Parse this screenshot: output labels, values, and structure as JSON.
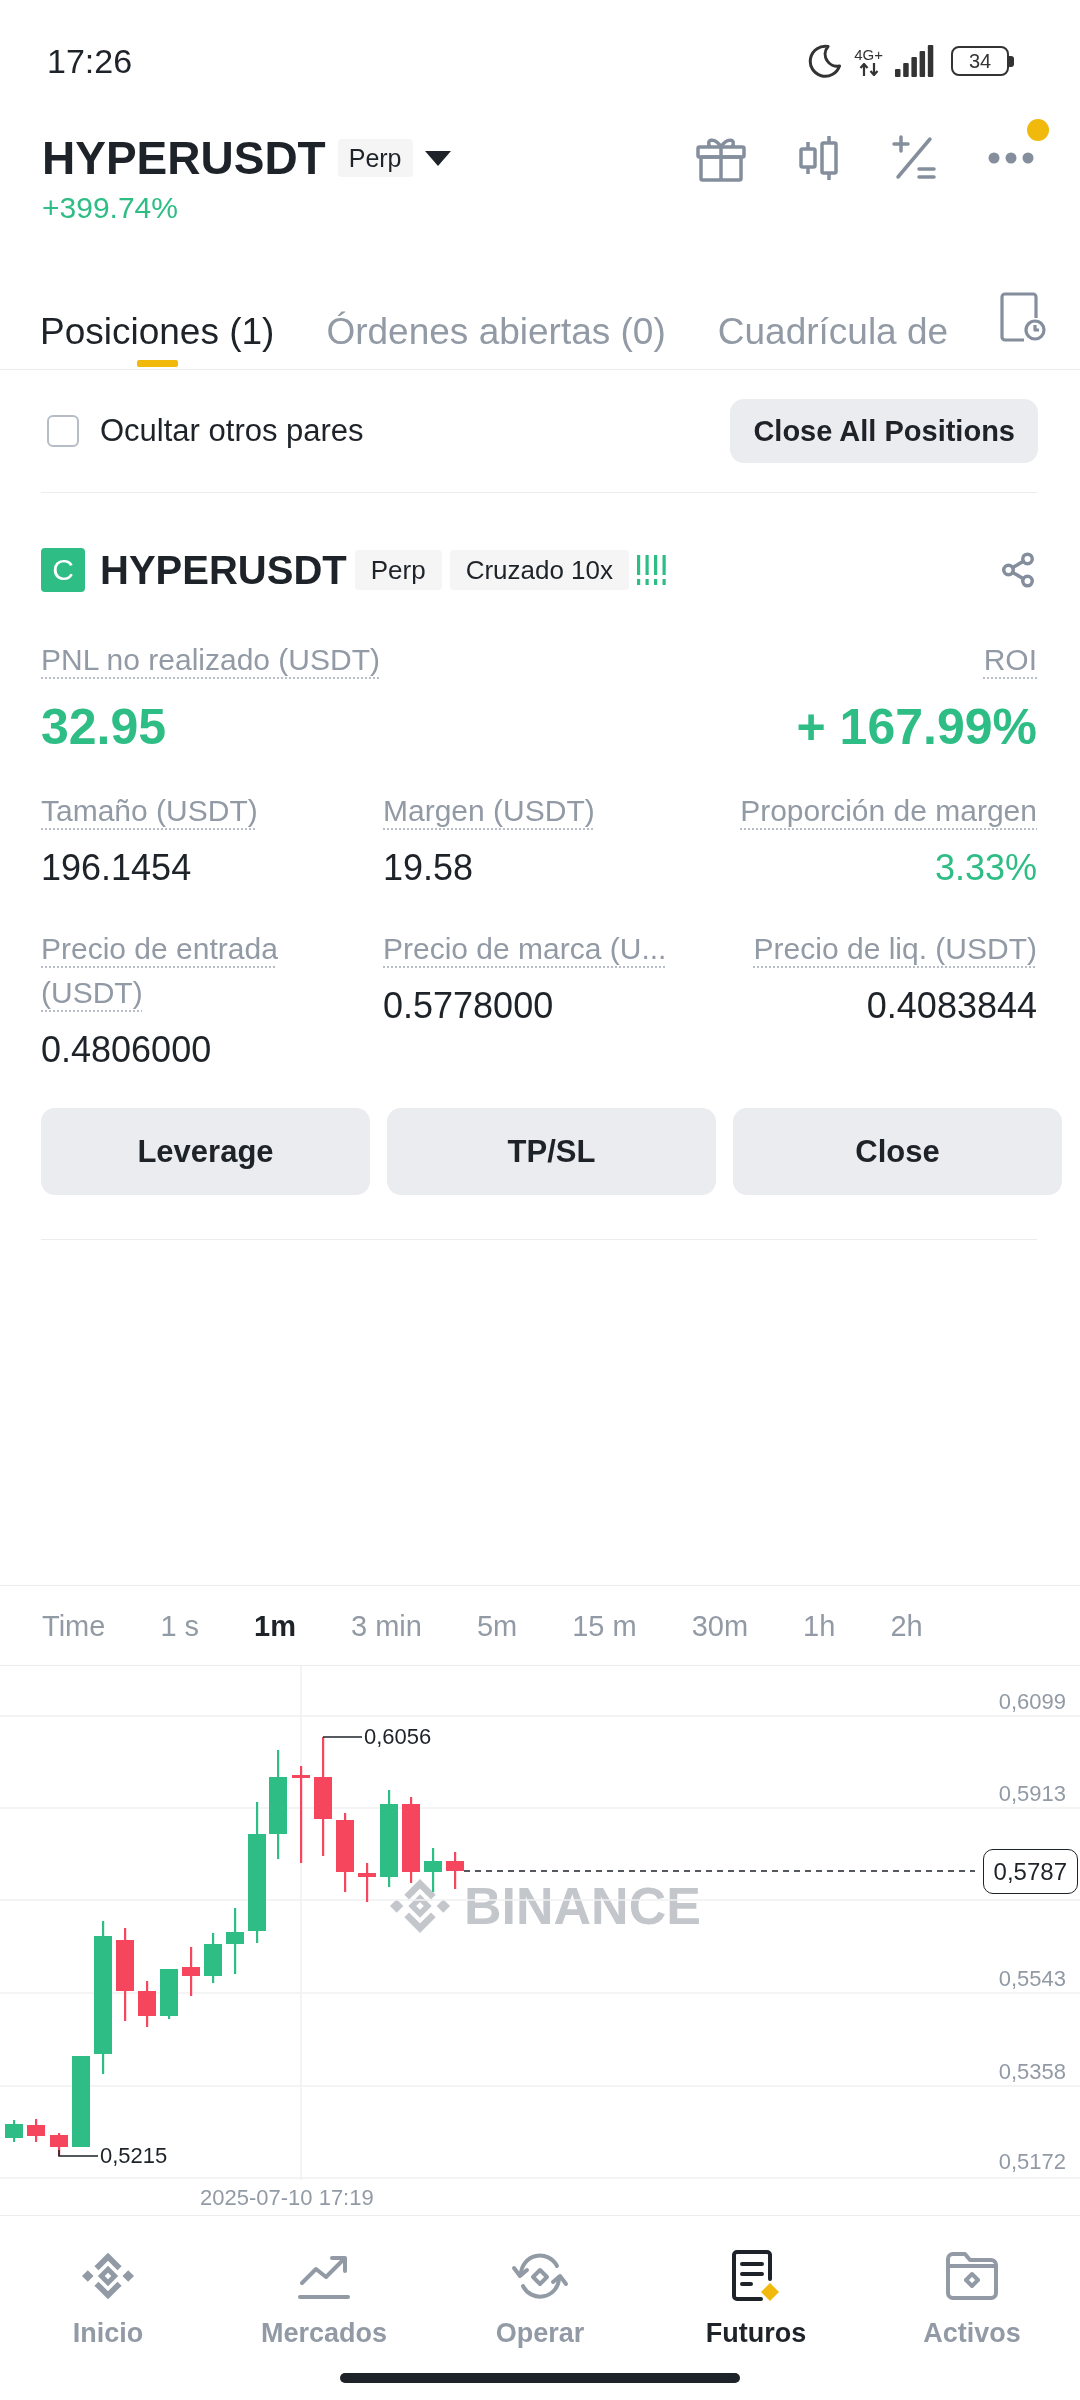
{
  "status_bar": {
    "time": "17:26",
    "network": "4G+",
    "battery": "34"
  },
  "header": {
    "symbol": "HYPERUSDT",
    "tag": "Perp",
    "change": "+399.74%",
    "menu_notification": true
  },
  "tabs": [
    {
      "label": "Posiciones (1)",
      "selected": true
    },
    {
      "label": "Órdenes abiertas (0)",
      "selected": false
    },
    {
      "label": "Cuadrícula de",
      "selected": false
    }
  ],
  "filter": {
    "label": "Ocultar otros pares",
    "checked": false,
    "button": "Close All Positions"
  },
  "position": {
    "badge": "C",
    "symbol": "HYPERUSDT",
    "tags": [
      "Perp",
      "Cruzado 10x"
    ],
    "pnl_label": "PNL no realizado (USDT)",
    "pnl": "32.95",
    "roi_label": "ROI",
    "roi": "+ 167.99%",
    "fields": [
      {
        "label": "Tamaño (USDT)",
        "value": "196.1454",
        "color": "#1e2329"
      },
      {
        "label": "Margen (USDT)",
        "value": "19.58",
        "color": "#1e2329"
      },
      {
        "label": "Proporción de margen",
        "value": "3.33%",
        "color": "#2ebd85"
      },
      {
        "label": "Precio de entrada (USDT)",
        "value": "0.4806000",
        "color": "#1e2329"
      },
      {
        "label": "Precio de marca (U...",
        "value": "0.5778000",
        "color": "#1e2329"
      },
      {
        "label": "Precio de liq. (USDT)",
        "value": "0.4083844",
        "color": "#1e2329"
      }
    ],
    "actions": [
      "Leverage",
      "TP/SL",
      "Close"
    ]
  },
  "intervals": [
    {
      "label": "Time",
      "selected": false
    },
    {
      "label": "1 s",
      "selected": false
    },
    {
      "label": "1m",
      "selected": true
    },
    {
      "label": "3 min",
      "selected": false
    },
    {
      "label": "5m",
      "selected": false
    },
    {
      "label": "15 m",
      "selected": false
    },
    {
      "label": "30m",
      "selected": false
    },
    {
      "label": "1h",
      "selected": false
    },
    {
      "label": "2h",
      "selected": false
    }
  ],
  "chart": {
    "y_labels": [
      "0,6099",
      "0,5913",
      "0,5543",
      "0,5358",
      "0,5172"
    ],
    "high": "0,6056",
    "low": "0,5215",
    "last_price": "0,5787",
    "time": "2025-07-10 17:19",
    "watermark": "BINANCE"
  },
  "bottom_nav": [
    {
      "label": "Inicio",
      "selected": false
    },
    {
      "label": "Mercados",
      "selected": false
    },
    {
      "label": "Operar",
      "selected": false
    },
    {
      "label": "Futuros",
      "selected": true
    },
    {
      "label": "Activos",
      "selected": false
    }
  ]
}
